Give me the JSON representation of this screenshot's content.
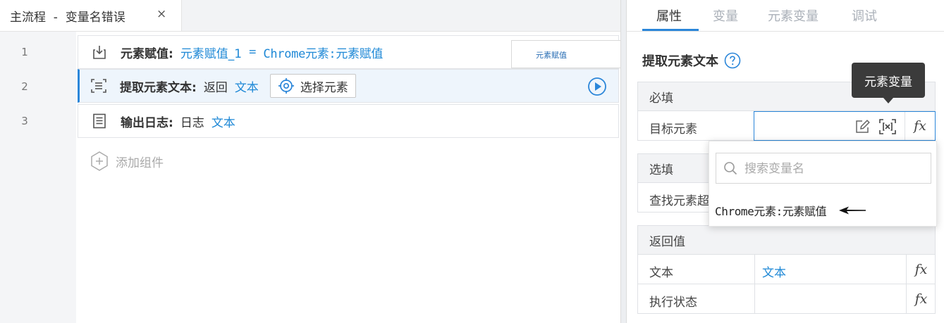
{
  "editor": {
    "tab_title": "主流程  -  变量名错误",
    "tab_close": "×",
    "line_numbers": [
      "1",
      "2",
      "3"
    ],
    "rows": [
      {
        "name": "元素赋值:",
        "target": "元素赋值_1",
        "op": "=",
        "source": "Chrome元素:元素赋值",
        "preview": "元素赋值"
      },
      {
        "name": "提取元素文本:",
        "text1": "返回",
        "text2": "文本",
        "button": "选择元素"
      },
      {
        "name": "输出日志:",
        "text1": "日志",
        "text2": "文本"
      }
    ],
    "add_component": "添加组件"
  },
  "panel": {
    "tabs": [
      "属性",
      "变量",
      "元素变量",
      "调试"
    ],
    "active_tab": 0,
    "title": "提取元素文本",
    "sections": {
      "required": {
        "label": "必填",
        "rows": [
          {
            "label": "目标元素"
          }
        ]
      },
      "optional": {
        "label": "选填",
        "rows": [
          {
            "label": "查找元素超"
          }
        ]
      },
      "returns": {
        "label": "返回值",
        "rows": [
          {
            "label": "文本",
            "value": "文本"
          },
          {
            "label": "执行状态",
            "value": ""
          }
        ]
      }
    },
    "fx_label": "fx",
    "tooltip": "元素变量",
    "dropdown": {
      "search_placeholder": "搜索变量名",
      "options": [
        "Chrome元素:元素赋值"
      ]
    }
  },
  "colors": {
    "accent": "#2b86d9",
    "link": "#1e88d6",
    "tooltip_bg": "#3b3b3b"
  }
}
